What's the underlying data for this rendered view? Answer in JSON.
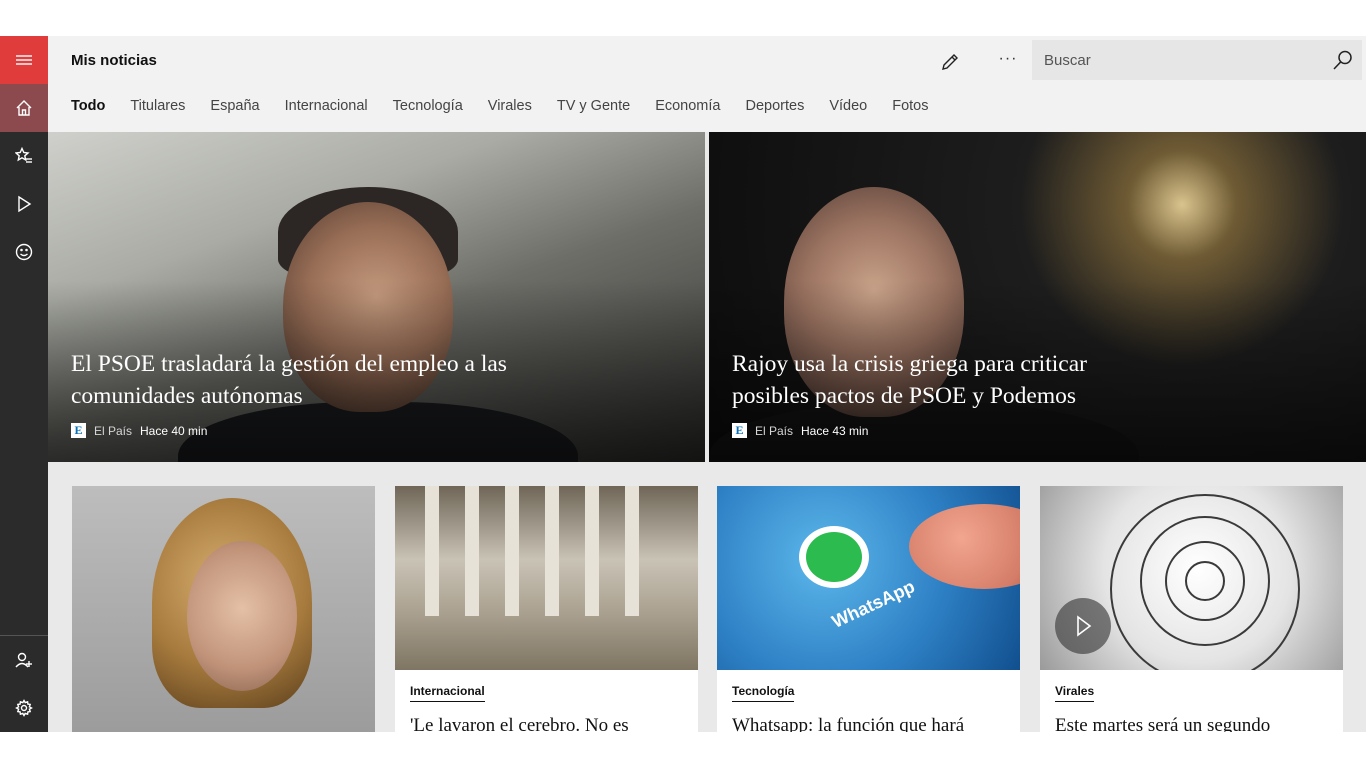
{
  "app": {
    "title": "Mis noticias"
  },
  "search": {
    "placeholder": "Buscar"
  },
  "header": {
    "more_label": "···"
  },
  "tabs": [
    {
      "label": "Todo",
      "active": true
    },
    {
      "label": "Titulares"
    },
    {
      "label": "España"
    },
    {
      "label": "Internacional"
    },
    {
      "label": "Tecnología"
    },
    {
      "label": "Virales"
    },
    {
      "label": "TV y Gente"
    },
    {
      "label": "Economía"
    },
    {
      "label": "Deportes"
    },
    {
      "label": "Vídeo"
    },
    {
      "label": "Fotos"
    }
  ],
  "rail": {
    "icons": [
      "hamburger-icon",
      "home-icon",
      "favorites-icon",
      "play-icon",
      "emoji-icon",
      "add-user-icon",
      "gear-icon"
    ],
    "accent_color": "#e03c3c",
    "selected_color": "#8c4a4e"
  },
  "heroes": [
    {
      "title": "El PSOE trasladará la gestión del empleo a las comunidades autónomas",
      "source_logo": "E",
      "source": "El País",
      "time": "Hace 40 min"
    },
    {
      "title": "Rajoy usa la crisis griega para criticar posibles pactos de PSOE y Podemos",
      "source_logo": "E",
      "source": "El País",
      "time": "Hace 43 min"
    }
  ],
  "cards": [
    {
      "category": "",
      "title": ""
    },
    {
      "category": "Internacional",
      "title": "'Le lavaron el cerebro. No es"
    },
    {
      "category": "Tecnología",
      "title": "Whatsapp: la función que hará",
      "image_text": "WhatsApp"
    },
    {
      "category": "Virales",
      "title": "Este martes será un segundo",
      "has_video": true
    }
  ]
}
